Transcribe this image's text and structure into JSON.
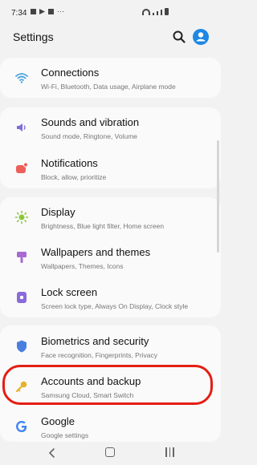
{
  "status": {
    "time": "7:34"
  },
  "header": {
    "title": "Settings"
  },
  "items": [
    {
      "title": "Connections",
      "subtitle": "Wi-Fi, Bluetooth, Data usage, Airplane mode",
      "icon": "wifi-icon",
      "color": "#4aa3e0"
    },
    {
      "title": "Sounds and vibration",
      "subtitle": "Sound mode, Ringtone, Volume",
      "icon": "speaker-icon",
      "color": "#7c6fd6"
    },
    {
      "title": "Notifications",
      "subtitle": "Block, allow, prioritize",
      "icon": "notification-icon",
      "color": "#ec5f5a"
    },
    {
      "title": "Display",
      "subtitle": "Brightness, Blue light filter, Home screen",
      "icon": "sun-icon",
      "color": "#8cc63f"
    },
    {
      "title": "Wallpapers and themes",
      "subtitle": "Wallpapers, Themes, Icons",
      "icon": "paintbrush-icon",
      "color": "#a86ad1"
    },
    {
      "title": "Lock screen",
      "subtitle": "Screen lock type, Always On Display, Clock style",
      "icon": "lock-icon",
      "color": "#8a6bd9"
    },
    {
      "title": "Biometrics and security",
      "subtitle": "Face recognition, Fingerprints, Privacy",
      "icon": "shield-icon",
      "color": "#4a7fe0"
    },
    {
      "title": "Accounts and backup",
      "subtitle": "Samsung Cloud, Smart Switch",
      "icon": "key-icon",
      "color": "#e5b22a"
    },
    {
      "title": "Google",
      "subtitle": "Google settings",
      "icon": "google-icon",
      "color": "#4285f4"
    }
  ],
  "highlight_color": "#e41e13"
}
